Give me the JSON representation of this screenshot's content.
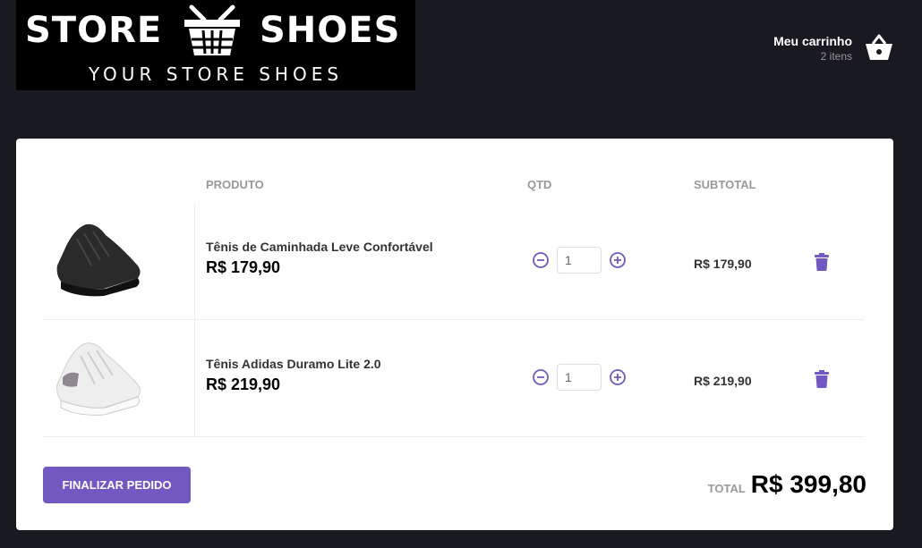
{
  "header": {
    "logo": {
      "word_left": "STORE",
      "word_right": "SHOES",
      "tagline": "YOUR STORE SHOES"
    },
    "cart": {
      "title": "Meu carrinho",
      "count": "2 itens",
      "icon": "basket-icon"
    }
  },
  "table": {
    "headers": {
      "product": "PRODUTO",
      "quantity": "QTD",
      "subtotal": "SUBTOTAL"
    },
    "rows": [
      {
        "name": "Tênis de Caminhada Leve Confortável",
        "price": "R$ 179,90",
        "quantity": "1",
        "subtotal": "R$ 179,90",
        "shoe_color": "#222222"
      },
      {
        "name": "Tênis Adidas Duramo Lite 2.0",
        "price": "R$ 219,90",
        "quantity": "1",
        "subtotal": "R$ 219,90",
        "shoe_color": "#f2f2f2"
      }
    ]
  },
  "footer": {
    "finish_label": "FINALIZAR PEDIDO",
    "total_label": "TOTAL",
    "total_value": "R$ 399,80"
  },
  "colors": {
    "accent": "#7159c1",
    "background": "#191920"
  }
}
